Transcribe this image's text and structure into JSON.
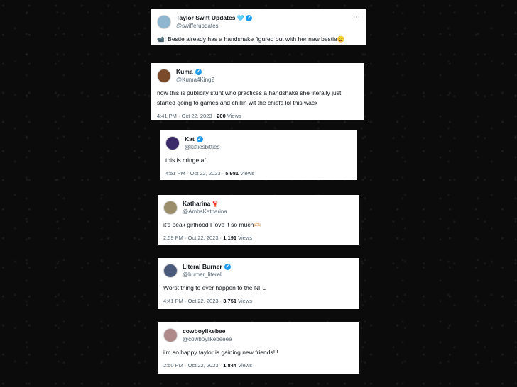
{
  "tweets": [
    {
      "name": "Taylor Swift Updates",
      "name_emoji": "🩵",
      "handle": "@swifferupdates",
      "text": "📹| Bestie already has a handshake figured out with her new bestie😄",
      "time": "",
      "date": "",
      "views": "",
      "views_label": "",
      "avatar_color": "#8fb6cf"
    },
    {
      "name": "Kuma",
      "handle": "@Kuma4King2",
      "text": "now this is publicity stunt who practices a handshake she literally just started going to games and chillin wit the chiefs lol this wack",
      "time": "4:41 PM",
      "date": "Oct 22, 2023",
      "views": "200",
      "views_label": "Views",
      "avatar_color": "#7a4a2a"
    },
    {
      "name": "Kat",
      "handle": "@kittiesbitties",
      "text": "this is cringe af",
      "time": "4:51 PM",
      "date": "Oct 22, 2023",
      "views": "5,981",
      "views_label": "Views",
      "avatar_color": "#3a2a6a"
    },
    {
      "name": "Katharina",
      "name_emoji": "🦞",
      "handle": "@AmbsKatharina",
      "text": "it's peak girlhood I love it so much🫶🏻",
      "time": "2:59 PM",
      "date": "Oct 22, 2023",
      "views": "1,191",
      "views_label": "Views",
      "avatar_color": "#9a8f6a"
    },
    {
      "name": "Literal Burner",
      "handle": "@burner_literal",
      "text": "Worst thing to ever happen to the NFL",
      "time": "4:41 PM",
      "date": "Oct 22, 2023",
      "views": "3,751",
      "views_label": "Views",
      "avatar_color": "#4a5a7a"
    },
    {
      "name": "cowboylikebee",
      "handle": "@cowboylikebeeee",
      "text": "i'm so happy taylor is gaining new friends!!!",
      "time": "2:50 PM",
      "date": "Oct 22, 2023",
      "views": "1,844",
      "views_label": "Views",
      "avatar_color": "#b08a8a"
    }
  ],
  "ui": {
    "verified_color": "#1d9bf0",
    "more_icon": "more-dots-icon",
    "separator": "·"
  }
}
